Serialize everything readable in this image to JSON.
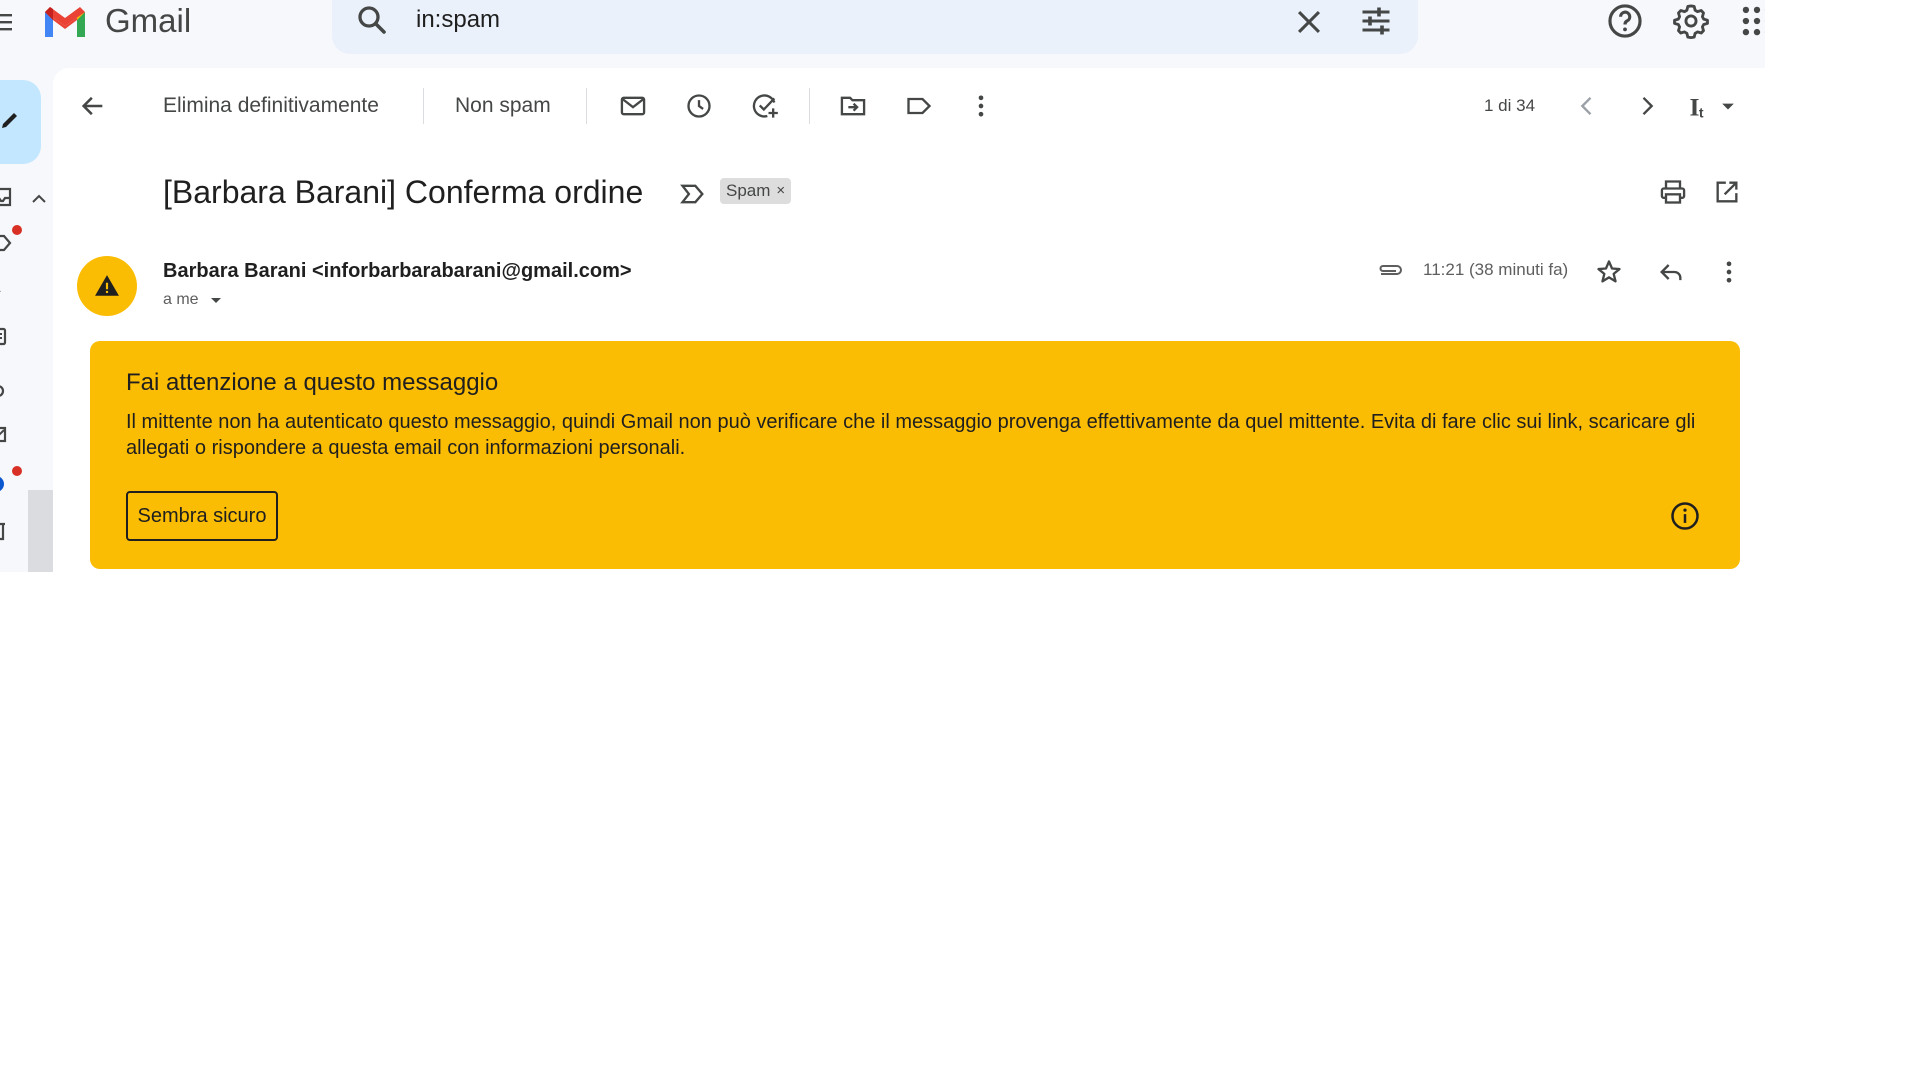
{
  "app": {
    "name": "Gmail"
  },
  "search": {
    "query": "in:spam"
  },
  "toolbar": {
    "delete_forever": "Elimina definitivamente",
    "not_spam": "Non spam",
    "page_count": "1 di 34"
  },
  "email": {
    "subject": "[Barbara Barani] Conferma ordine",
    "label": "Spam",
    "label_remove": "×",
    "sender": "Barbara Barani <inforbarbarabarani@gmail.com>",
    "recipient": "a me",
    "time": "11:21 (38 minuti fa)"
  },
  "warning": {
    "title": "Fai attenzione a questo messaggio",
    "body": "Il mittente non ha autenticato questo messaggio, quindi Gmail non può verificare che il messaggio provenga effettivamente da quel mittente. Evita di fare clic sui link, scaricare gli allegati o rispondere a questa email con informazioni personali.",
    "button": "Sembra sicuro"
  },
  "colors": {
    "warning_bg": "#fbbc04",
    "search_bg": "#eaf1fb",
    "compose_bg": "#c2e7ff",
    "notification_dot": "#d93025"
  }
}
